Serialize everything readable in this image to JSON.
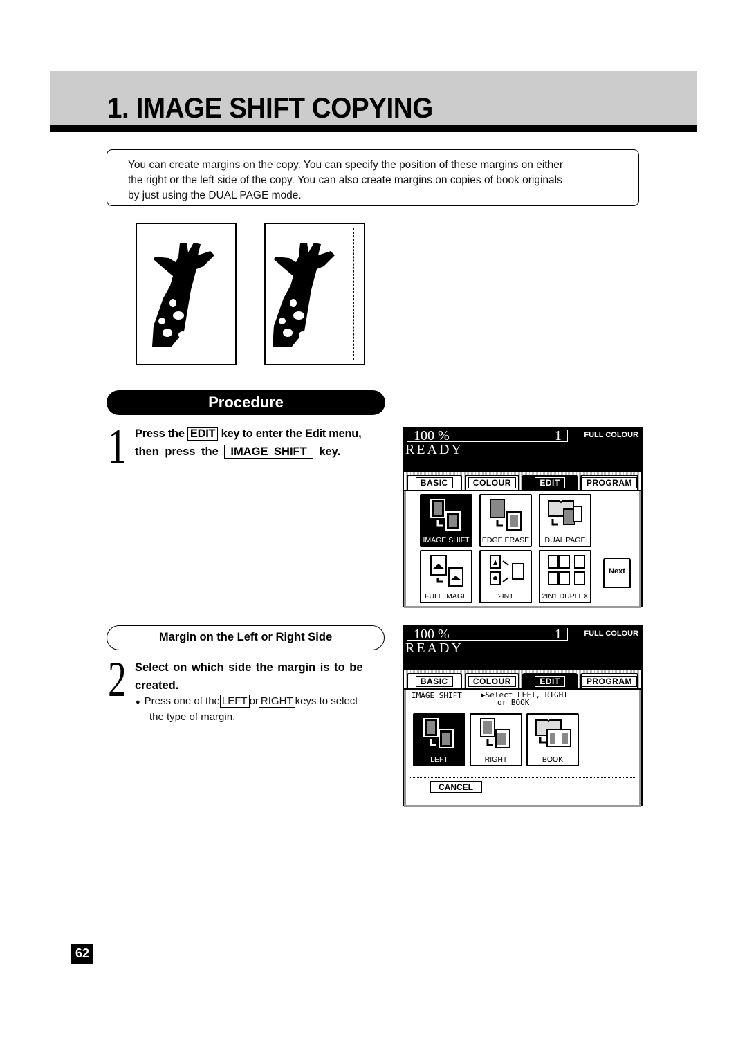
{
  "header": {
    "title": "1. IMAGE SHIFT COPYING"
  },
  "intro": {
    "lines": [
      "You can create margins on the copy. You can specify the position of these margins on either",
      "the right or the left side of the copy. You can also create margins on copies of book originals",
      "by just using the DUAL PAGE mode."
    ]
  },
  "illustrations": [
    {
      "name": "left-margin-example",
      "margin_side": "left"
    },
    {
      "name": "right-margin-example",
      "margin_side": "right"
    }
  ],
  "procedure": {
    "label": "Procedure",
    "step1": {
      "number": "1",
      "part1": "Press the",
      "key1": "EDIT",
      "part2": "key to enter the Edit menu,",
      "part3": "then press the",
      "key2": "IMAGE SHIFT",
      "part4": "key."
    },
    "subsection": "Margin on the Left or Right Side",
    "step2": {
      "number": "2",
      "line1": "Select on which side the margin is to be",
      "line2": "created.",
      "bullet": "●",
      "b_part1": "Press one of the",
      "key1": "LEFT",
      "b_part2": "or",
      "key2": "RIGHT",
      "b_part3": "keys to select",
      "b_line2": "the type of margin."
    }
  },
  "screen1": {
    "zoom": "100 %",
    "copies": "1",
    "color_mode": "FULL COLOUR",
    "status": "READY",
    "tabs": [
      "BASIC",
      "COLOUR",
      "EDIT",
      "PROGRAM"
    ],
    "active_tab": "EDIT",
    "functions": [
      "IMAGE SHIFT",
      "EDGE ERASE",
      "DUAL PAGE",
      "FULL IMAGE",
      "2IN1",
      "2IN1 DUPLEX"
    ],
    "selected_function": "IMAGE SHIFT",
    "next_label": "Next"
  },
  "screen2": {
    "zoom": "100 %",
    "copies": "1",
    "color_mode": "FULL COLOUR",
    "status": "READY",
    "tabs": [
      "BASIC",
      "COLOUR",
      "EDIT",
      "PROGRAM"
    ],
    "active_tab": "EDIT",
    "mode_label": "IMAGE SHIFT",
    "prompt_line1": "▶Select LEFT, RIGHT",
    "prompt_line2": "or BOOK",
    "options": [
      "LEFT",
      "RIGHT",
      "BOOK"
    ],
    "selected_option": "LEFT",
    "cancel_label": "CANCEL"
  },
  "footer": {
    "page_number": "62"
  }
}
